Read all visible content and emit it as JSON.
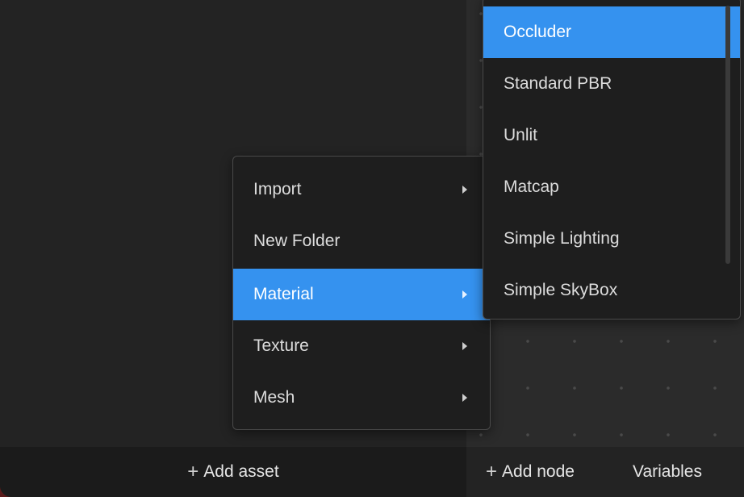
{
  "left_panel": {
    "footer": {
      "add_asset_label": "Add asset",
      "plus_icon": "+"
    }
  },
  "right_panel": {
    "footer": {
      "add_node_label": "Add node",
      "plus_icon": "+",
      "variables_label": "Variables"
    }
  },
  "context_menu": {
    "items": [
      {
        "label": "Import",
        "has_submenu": true
      },
      {
        "label": "New Folder",
        "has_submenu": false
      },
      {
        "label": "Material",
        "has_submenu": true,
        "active": true
      },
      {
        "label": "Texture",
        "has_submenu": true
      },
      {
        "label": "Mesh",
        "has_submenu": true
      }
    ]
  },
  "material_submenu": {
    "items": [
      {
        "label": "Occluder",
        "active": true
      },
      {
        "label": "Standard PBR"
      },
      {
        "label": "Unlit"
      },
      {
        "label": "Matcap"
      },
      {
        "label": "Simple Lighting"
      },
      {
        "label": "Simple SkyBox"
      }
    ]
  },
  "colors": {
    "accent": "#3592ef",
    "menu_bg": "#1e1e1e",
    "panel_bg": "#232323"
  }
}
